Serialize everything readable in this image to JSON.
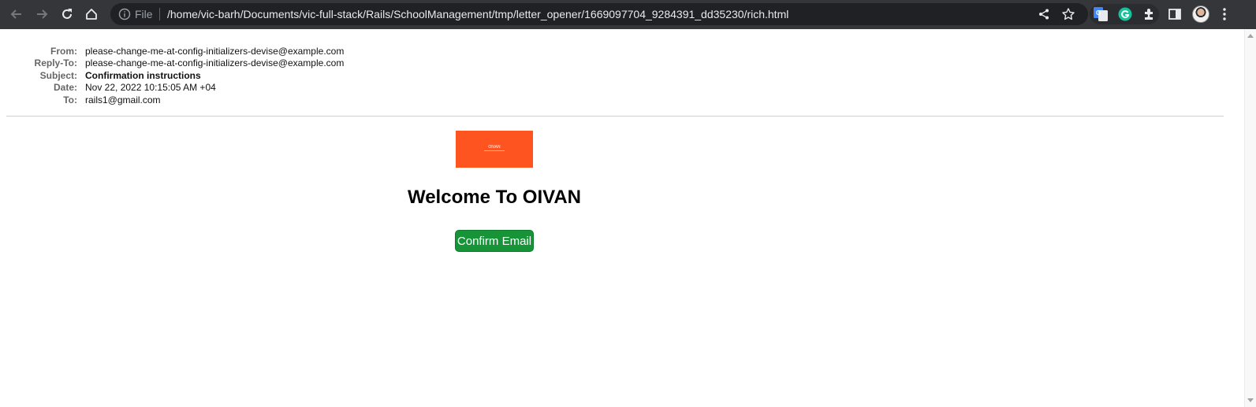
{
  "browser": {
    "file_label": "File",
    "url": "/home/vic-barh/Documents/vic-full-stack/Rails/SchoolManagement/tmp/letter_opener/1669097704_9284391_dd35230/rich.html",
    "icons": [
      "back-icon",
      "forward-icon",
      "reload-icon",
      "home-icon",
      "info-icon",
      "share-icon",
      "star-icon",
      "google-translate-icon",
      "grammarly-icon",
      "extensions-icon",
      "side-panel-icon",
      "profile-avatar",
      "more-menu-icon"
    ]
  },
  "email_headers": [
    {
      "label": "From:",
      "value": "please-change-me-at-config-initializers-devise@example.com",
      "bold": false
    },
    {
      "label": "Reply-To:",
      "value": "please-change-me-at-config-initializers-devise@example.com",
      "bold": false
    },
    {
      "label": "Subject:",
      "value": "Confirmation instructions",
      "bold": true
    },
    {
      "label": "Date:",
      "value": "Nov 22, 2022 10:15:05 AM +04",
      "bold": false
    },
    {
      "label": "To:",
      "value": "rails1@gmail.com",
      "bold": false
    }
  ],
  "email_body": {
    "banner_text": "OIVAN",
    "banner_color": "#fe5420",
    "heading": "Welcome To OIVAN",
    "confirm_button_label": "Confirm Email",
    "confirm_button_color": "#179438"
  }
}
